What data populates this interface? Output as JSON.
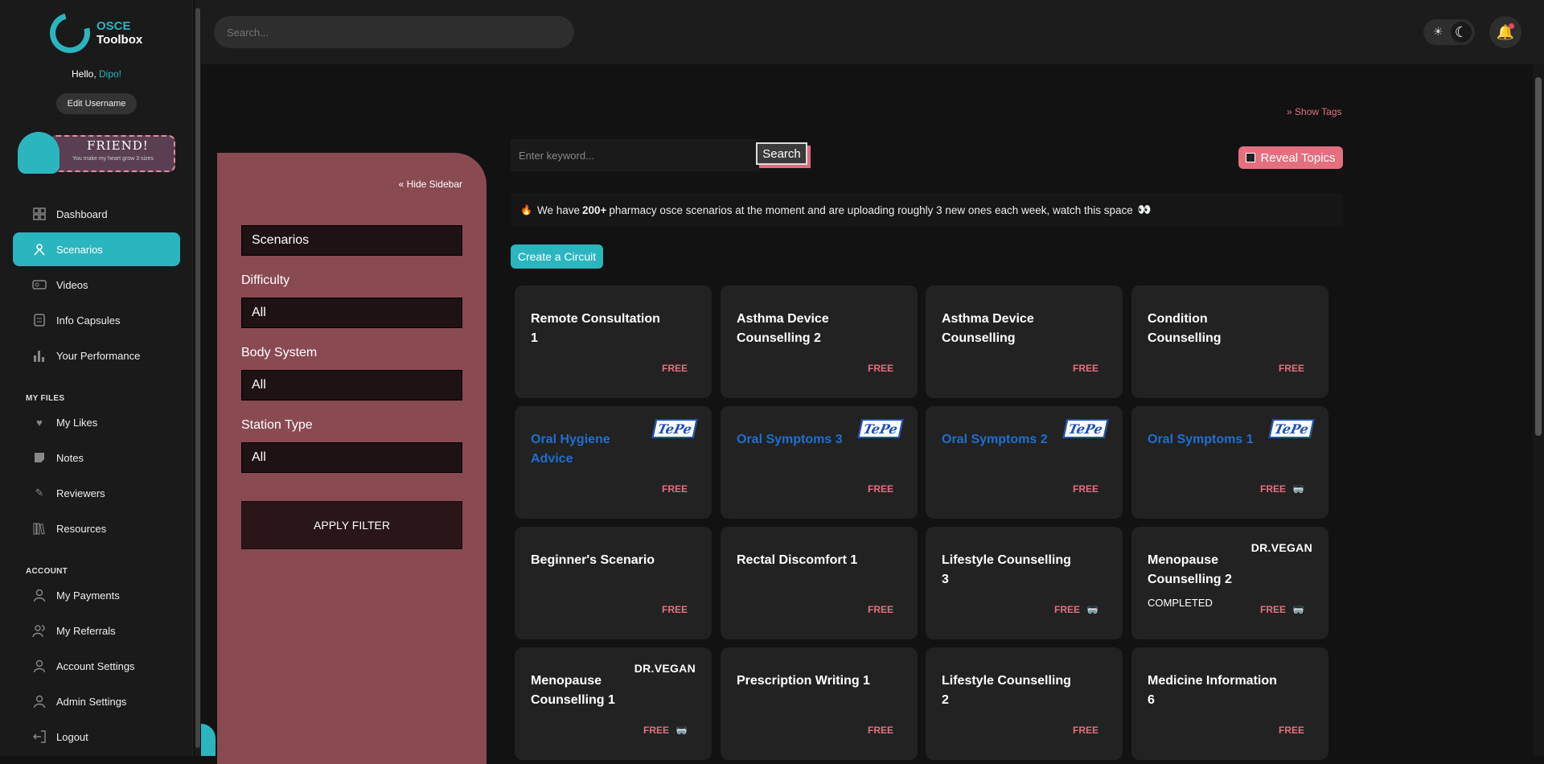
{
  "brand": {
    "line1": "OSCE",
    "line2": "Toolbox"
  },
  "greeting": {
    "prefix": "Hello, ",
    "name": "Dipo!"
  },
  "edit_username": "Edit Username",
  "friend_badge": {
    "title": "FRIEND!",
    "subtitle": "You make my heart grow 3 sizes"
  },
  "nav": {
    "main": [
      {
        "label": "Dashboard",
        "icon": "dashboard-icon"
      },
      {
        "label": "Scenarios",
        "icon": "scenarios-icon",
        "active": true
      },
      {
        "label": "Videos",
        "icon": "videos-icon"
      },
      {
        "label": "Info Capsules",
        "icon": "info-capsules-icon"
      },
      {
        "label": "Your Performance",
        "icon": "performance-icon"
      }
    ],
    "my_files_heading": "MY FILES",
    "my_files": [
      {
        "label": "My Likes",
        "icon": "heart-icon"
      },
      {
        "label": "Notes",
        "icon": "notes-icon"
      },
      {
        "label": "Reviewers",
        "icon": "pencil-icon"
      },
      {
        "label": "Resources",
        "icon": "books-icon"
      }
    ],
    "account_heading": "ACCOUNT",
    "account": [
      {
        "label": "My Payments",
        "icon": "user-icon"
      },
      {
        "label": "My Referrals",
        "icon": "users-icon"
      },
      {
        "label": "Account Settings",
        "icon": "user-icon"
      },
      {
        "label": "Admin Settings",
        "icon": "user-icon"
      },
      {
        "label": "Logout",
        "icon": "logout-icon"
      }
    ]
  },
  "topbar": {
    "search_placeholder": "Search..."
  },
  "filters": {
    "hide_sidebar": "Hide Sidebar",
    "category": "Scenarios",
    "difficulty_label": "Difficulty",
    "difficulty_value": "All",
    "body_system_label": "Body System",
    "body_system_value": "All",
    "station_type_label": "Station Type",
    "station_type_value": "All",
    "apply": "APPLY FILTER"
  },
  "toolbar": {
    "keyword_placeholder": "Enter keyword...",
    "search_btn": "Search",
    "show_tags": "Show Tags",
    "reveal_topics": "Reveal Topics",
    "create_circuit": "Create a Circuit"
  },
  "info": {
    "pre": "We have",
    "count": "200+",
    "post": "pharmacy osce scenarios at the moment and are uploading roughly 3 new ones each week, watch this space"
  },
  "cards": [
    {
      "title": "Remote Consultation 1",
      "tag": "FREE"
    },
    {
      "title": "Asthma Device Counselling 2",
      "tag": "FREE"
    },
    {
      "title": "Asthma Device Counselling",
      "tag": "FREE"
    },
    {
      "title": "Condition Counselling",
      "tag": "FREE"
    },
    {
      "title": "Oral Hygiene Advice",
      "tag": "FREE",
      "sponsor": "TePe"
    },
    {
      "title": "Oral Symptoms 3",
      "tag": "FREE",
      "sponsor": "TePe"
    },
    {
      "title": "Oral Symptoms 2",
      "tag": "FREE",
      "sponsor": "TePe"
    },
    {
      "title": "Oral Symptoms 1",
      "tag": "FREE",
      "sponsor": "TePe",
      "glasses": true
    },
    {
      "title": "Beginner's Scenario",
      "tag": "FREE"
    },
    {
      "title": "Rectal Discomfort 1",
      "tag": "FREE"
    },
    {
      "title": "Lifestyle Counselling 3",
      "tag": "FREE",
      "glasses": true
    },
    {
      "title": "Menopause Counselling 2",
      "tag": "FREE",
      "sponsor": "DR.VEGAN",
      "status": "COMPLETED",
      "glasses": true
    },
    {
      "title": "Menopause Counselling 1",
      "tag": "FREE",
      "sponsor": "DR.VEGAN",
      "glasses": true
    },
    {
      "title": "Prescription Writing 1",
      "tag": "FREE"
    },
    {
      "title": "Lifestyle Counselling 2",
      "tag": "FREE"
    },
    {
      "title": "Medicine Information 6",
      "tag": "FREE"
    }
  ]
}
